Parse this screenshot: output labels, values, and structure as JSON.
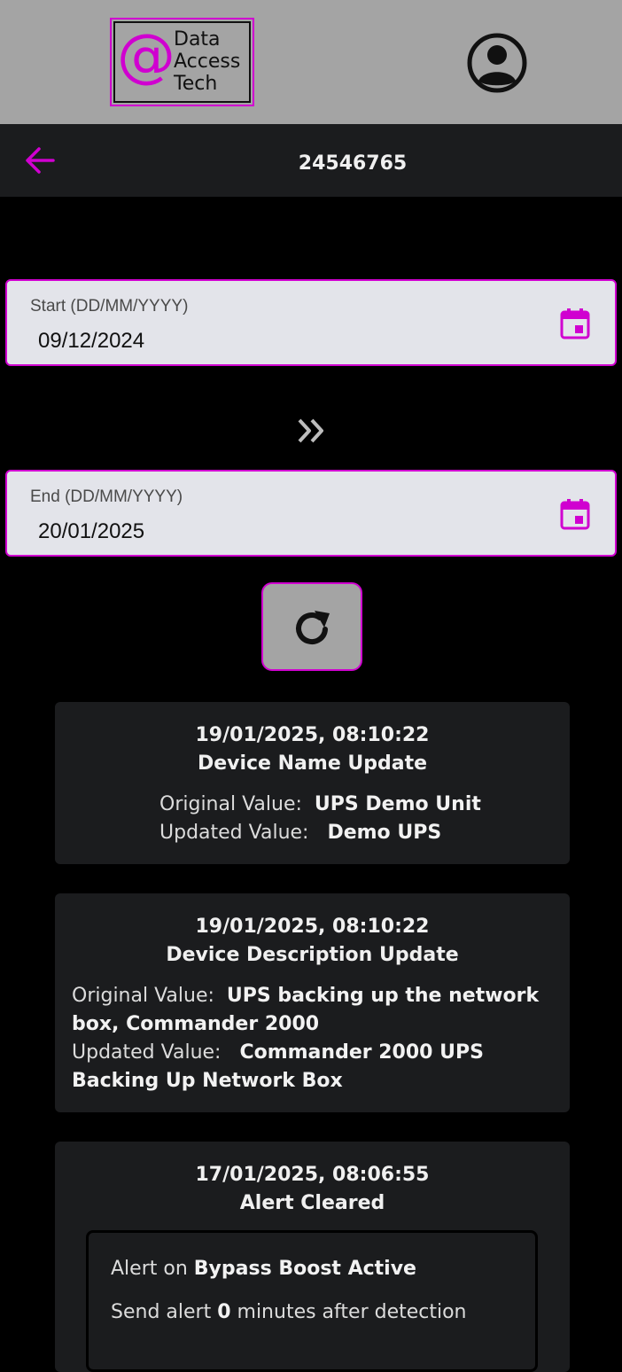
{
  "header": {
    "logo_words": [
      "Data",
      "Access",
      "Tech"
    ],
    "logo_symbol": "@",
    "accent_color": "#d000d0",
    "avatar_icon": "account-circle-icon"
  },
  "nav": {
    "back_icon": "arrow-left-icon",
    "title": "24546765"
  },
  "filters": {
    "start": {
      "label": "Start (DD/MM/YYYY)",
      "value": "09/12/2024",
      "icon": "calendar-icon"
    },
    "end": {
      "label": "End (DD/MM/YYYY)",
      "value": "20/01/2025",
      "icon": "calendar-icon"
    },
    "range_icon": "double-chevron-right-icon",
    "refresh_icon": "refresh-icon"
  },
  "events": [
    {
      "timestamp": "19/01/2025, 08:10:22",
      "event": "Device Name Update",
      "original_label": "Original Value:",
      "original_value": "UPS Demo Unit",
      "updated_label": "Updated Value:",
      "updated_value": "Demo UPS"
    },
    {
      "timestamp": "19/01/2025, 08:10:22",
      "event": "Device Description Update",
      "original_label": "Original Value:",
      "original_value": "UPS backing up the network box, Commander 2000",
      "updated_label": "Updated Value:",
      "updated_value": "Commander 2000 UPS Backing Up Network Box"
    },
    {
      "timestamp": "17/01/2025, 08:06:55",
      "event": "Alert Cleared",
      "alert_prefix": "Alert on",
      "alert_name": "Bypass Boost Active",
      "send_prefix": "Send alert",
      "send_minutes": "0",
      "send_suffix": "minutes after detection"
    }
  ]
}
